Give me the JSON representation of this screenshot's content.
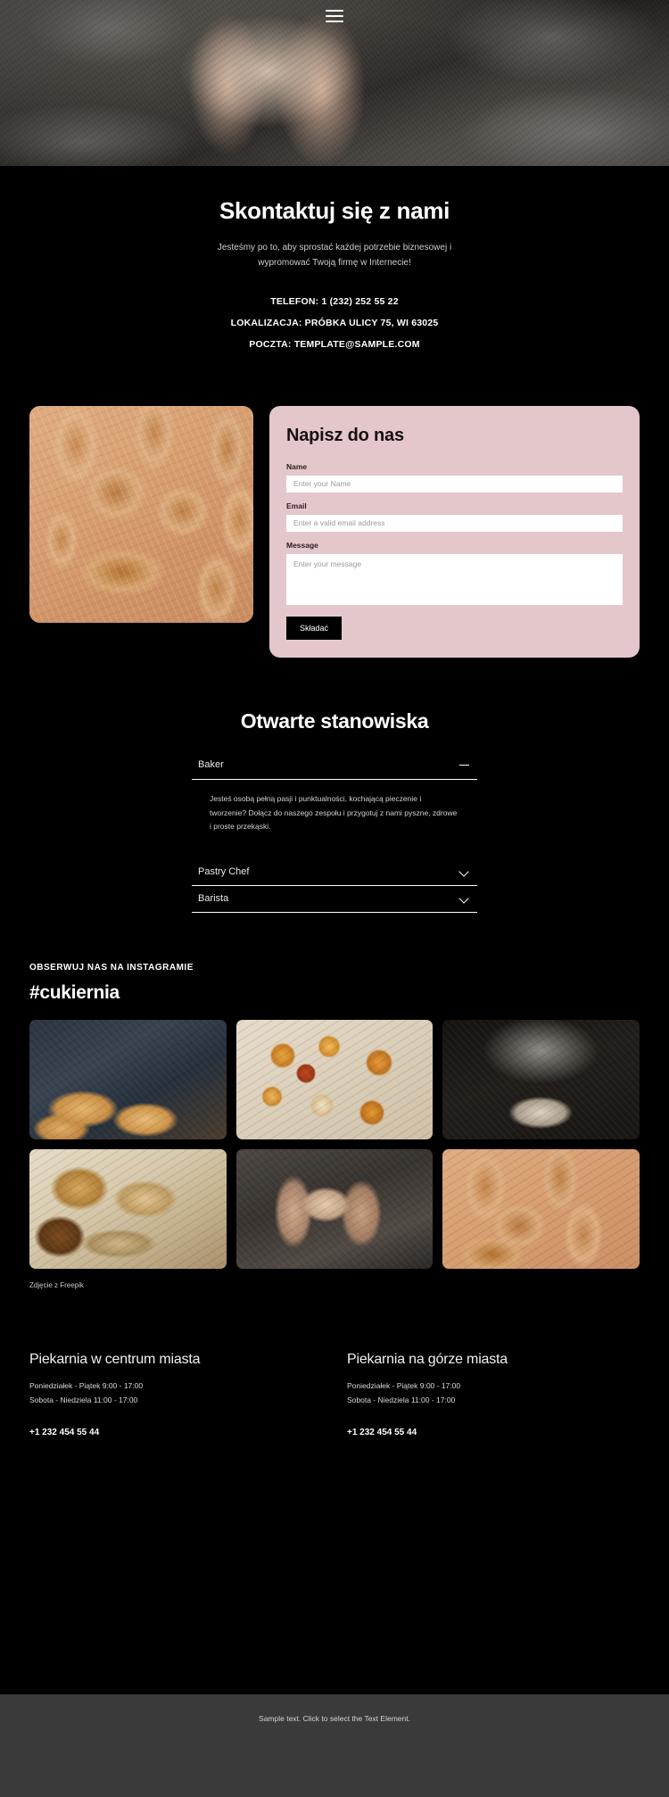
{
  "hero": {
    "menu_icon": "hamburger-menu-icon"
  },
  "contact": {
    "title": "Skontaktuj się z nami",
    "subtitle": "Jesteśmy po to, aby sprostać każdej potrzebie biznesowej i wypromować Twoją firmę w Internecie!",
    "phone_line": "TELEFON: 1 (232) 252 55 22",
    "location_line": "LOKALIZACJA: PRÓBKA ULICY 75, WI 63025",
    "email_line": "POCZTA: TEMPLATE@SAMPLE.COM"
  },
  "form": {
    "title": "Napisz do nas",
    "name_label": "Name",
    "name_placeholder": "Enter your Name",
    "name_value": "",
    "email_label": "Email",
    "email_placeholder": "Enter a valid email address",
    "email_value": "",
    "message_label": "Message",
    "message_placeholder": "Enter your message",
    "message_value": "",
    "submit_label": "Składać",
    "card_color": "#e4c7cb",
    "button_color": "#000000"
  },
  "positions": {
    "title": "Otwarte stanowiska",
    "items": [
      {
        "label": "Baker",
        "expanded": true,
        "icon": "minus-icon",
        "body": "Jesteś osobą pełną pasji i punktualności, kochającą pieczenie i tworzenie? Dołącz do naszego zespołu i przygotuj z nami pyszne, zdrowe i proste przekąski."
      },
      {
        "label": "Pastry Chef",
        "expanded": false,
        "icon": "chevron-down-icon",
        "body": ""
      },
      {
        "label": "Barista",
        "expanded": false,
        "icon": "chevron-down-icon",
        "body": ""
      }
    ]
  },
  "instagram": {
    "eyebrow": "OBSERWUJ NAS NA INSTAGRAMIE",
    "hashtag": "#cukiernia",
    "credit": "Zdjęcie z Freepik",
    "tiles": [
      {
        "alt": "baker-holding-tray-of-croissants"
      },
      {
        "alt": "assorted-pastries-flat-lay"
      },
      {
        "alt": "flour-dusting-over-dough"
      },
      {
        "alt": "rustic-bread-loaves-on-cloth"
      },
      {
        "alt": "hands-kneading-dough-on-table"
      },
      {
        "alt": "baguettes-and-bread-on-peach-background"
      }
    ]
  },
  "locations": [
    {
      "name": "Piekarnia w centrum miasta",
      "weekday_hours": "Poniedziałek - Piątek 9:00 - 17:00",
      "weekend_hours": "Sobota - Niedziela 11:00 - 17:00",
      "phone": "+1 232 454 55 44"
    },
    {
      "name": "Piekarnia na górze miasta",
      "weekday_hours": "Poniedziałek - Piątek 9:00 - 17:00",
      "weekend_hours": "Sobota - Niedziela 11:00 - 17:00",
      "phone": "+1 232 454 55 44"
    }
  ],
  "footer": {
    "sample_text": "Sample text. Click to select the Text Element.",
    "background": "#3a3a3a"
  }
}
